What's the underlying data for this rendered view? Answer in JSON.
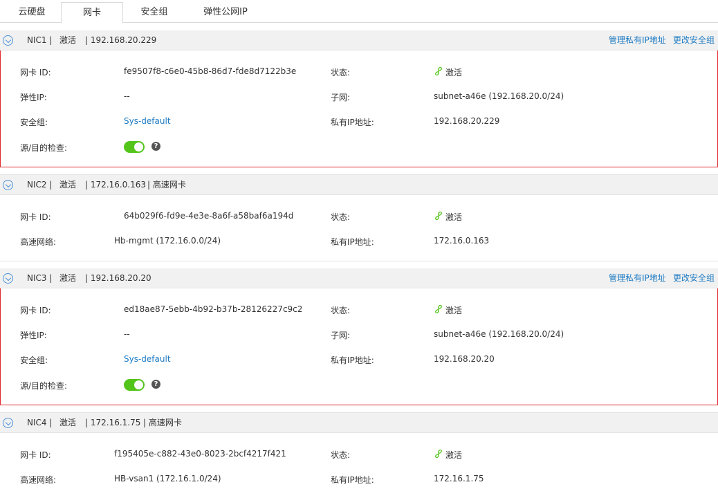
{
  "tabs": [
    "云硬盘",
    "网卡",
    "安全组",
    "弹性公网IP"
  ],
  "colors": {
    "accent": "#1e7bc3",
    "selected_border": "#e0262b",
    "status_active": "#52c41a",
    "switch_on": "#52c41a"
  },
  "icons": {
    "toggle": "chevron-down-circle-icon",
    "status": "link-icon",
    "help": "question-circle-icon"
  },
  "labels": {
    "nic_id": "网卡 ID:",
    "status": "状态:",
    "eip": "弹性IP:",
    "subnet": "子网:",
    "sg": "安全组:",
    "private_ip": "私有IP地址:",
    "src_dst_check": "源/目的检查:",
    "hs_network": "高速网络:"
  },
  "actions": {
    "manage_ip": "管理私有IP地址",
    "change_sg": "更改安全组"
  },
  "nics": [
    {
      "name": "NIC1 |",
      "state": "激活",
      "ip_header": "| 192.168.20.229",
      "type_tag": "",
      "nic_id": "fe9507f8-c6e0-45b8-86d7-fde8d7122b3e",
      "status": "激活",
      "eip": "--",
      "subnet": "subnet-a46e (192.168.20.0/24)",
      "sg": "Sys-default",
      "private_ip": "192.168.20.229",
      "src_dst_check": true
    },
    {
      "name": "NIC2 |",
      "state": "激活",
      "ip_header": "| 172.16.0.163",
      "type_tag": "| 高速网卡",
      "nic_id": "64b029f6-fd9e-4e3e-8a6f-a58baf6a194d",
      "status": "激活",
      "hs_network": "Hb-mgmt (172.16.0.0/24)",
      "private_ip": "172.16.0.163"
    },
    {
      "name": "NIC3 |",
      "state": "激活",
      "ip_header": "| 192.168.20.20",
      "type_tag": "",
      "nic_id": "ed18ae87-5ebb-4b92-b37b-28126227c9c2",
      "status": "激活",
      "eip": "--",
      "subnet": "subnet-a46e (192.168.20.0/24)",
      "sg": "Sys-default",
      "private_ip": "192.168.20.20",
      "src_dst_check": true
    },
    {
      "name": "NIC4 |",
      "state": "激活",
      "ip_header": "| 172.16.1.75",
      "type_tag": "| 高速网卡",
      "nic_id": "f195405e-c882-43e0-8023-2bcf4217f421",
      "status": "激活",
      "hs_network": "HB-vsan1 (172.16.1.0/24)",
      "private_ip": "172.16.1.75"
    }
  ]
}
